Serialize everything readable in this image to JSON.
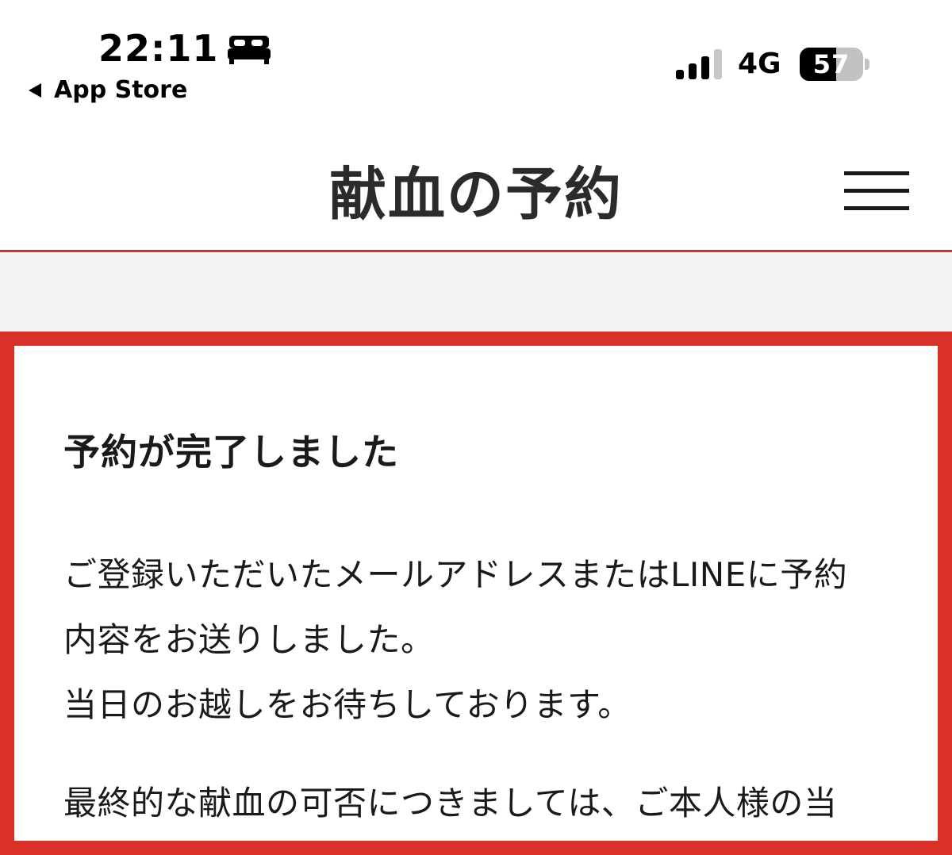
{
  "status_bar": {
    "time": "22:11",
    "focus_icon": "bed-icon",
    "back_label": "App Store",
    "signal_icon": "cellular-signal-icon",
    "network": "4G",
    "battery_level": "57",
    "battery_fraction": 0.57
  },
  "header": {
    "title": "献血の予約",
    "menu_icon": "hamburger-menu-icon",
    "accent_color": "#d9302a"
  },
  "card": {
    "heading": "予約が完了しました",
    "paragraph_1": "ご登録いただいたメールアドレスまたはLINEに予約\n内容をお送りしました。\n当日のお越しをお待ちしております。",
    "paragraph_2": "最終的な献血の可否につきましては、ご本人様の当",
    "border_color": "#d9302a"
  }
}
